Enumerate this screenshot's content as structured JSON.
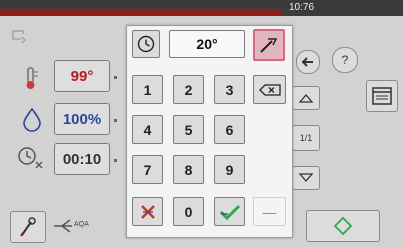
{
  "status_bar": {
    "time": "10:76"
  },
  "background": {
    "temperature_value": "99°",
    "humidity_value": "100%",
    "timer_value": "00:10",
    "page_indicator": "1/1",
    "help_label": "?",
    "bottom_label": "AQA"
  },
  "keypad": {
    "display_value": "20°",
    "keys": [
      "1",
      "2",
      "3",
      "4",
      "5",
      "6",
      "7",
      "8",
      "9",
      "0"
    ],
    "dash_label": "—"
  },
  "colors": {
    "top_bar": "#3b3b3b",
    "accent_red": "#8f1d1d",
    "selected_tool": "#e3b6bf",
    "confirm_green": "#2fa84f"
  }
}
